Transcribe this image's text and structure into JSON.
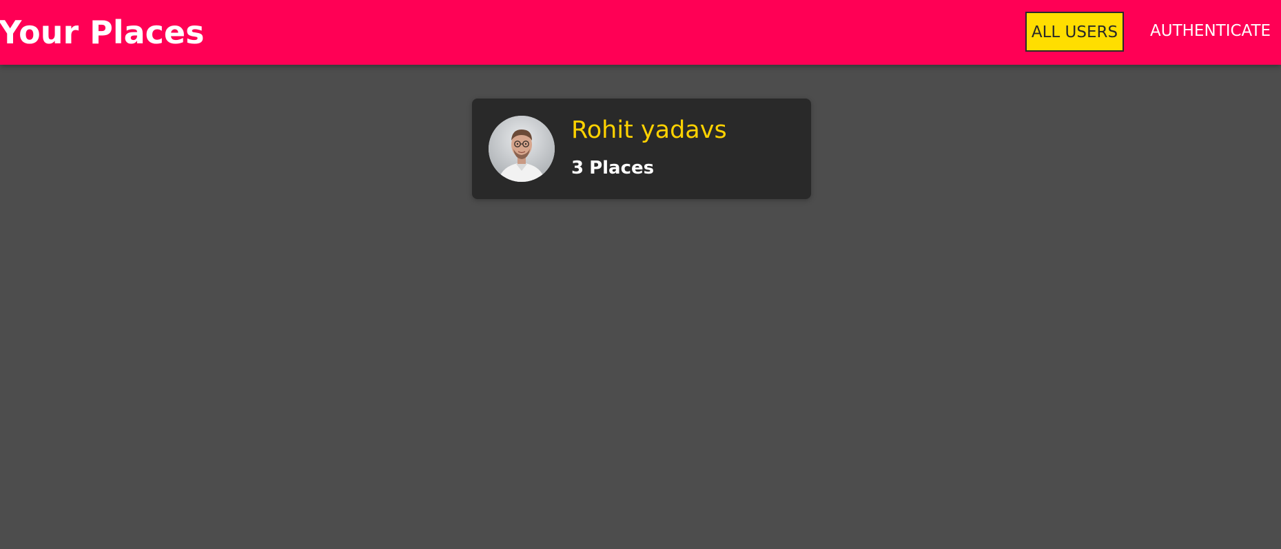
{
  "header": {
    "title": "Your Places",
    "nav": [
      {
        "label": "ALL USERS",
        "active": true
      },
      {
        "label": "AUTHENTICATE",
        "active": false
      }
    ]
  },
  "users": [
    {
      "name": "Rohit yadavs",
      "places_count": "3",
      "places_label": "Places",
      "avatar_icon": "user-portrait-photo"
    }
  ],
  "colors": {
    "header_bg": "#ff0055",
    "page_bg": "#4d4d4d",
    "card_bg": "#292929",
    "accent": "#ffde00",
    "name_color": "#ffd200"
  }
}
